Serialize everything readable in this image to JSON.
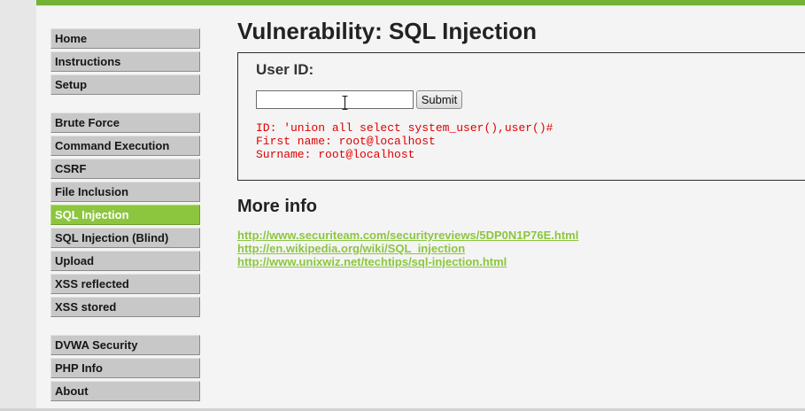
{
  "sidebar": {
    "groups": [
      [
        "Home",
        "Instructions",
        "Setup"
      ],
      [
        "Brute Force",
        "Command Execution",
        "CSRF",
        "File Inclusion",
        "SQL Injection",
        "SQL Injection (Blind)",
        "Upload",
        "XSS reflected",
        "XSS stored"
      ],
      [
        "DVWA Security",
        "PHP Info",
        "About"
      ]
    ],
    "selected": "SQL Injection"
  },
  "main": {
    "title": "Vulnerability: SQL Injection",
    "form": {
      "label": "User ID:",
      "input_value": "",
      "submit_label": "Submit"
    },
    "result": {
      "lines": [
        "ID: 'union all select system_user(),user()#",
        "First name: root@localhost",
        "Surname: root@localhost"
      ]
    },
    "more_info": {
      "heading": "More info",
      "links": [
        "http://www.securiteam.com/securityreviews/5DP0N1P76E.html",
        "http://en.wikipedia.org/wiki/SQL_injection",
        "http://www.unixwiz.net/techtips/sql-injection.html"
      ]
    }
  },
  "colors": {
    "accent": "#8cc63f",
    "top_bar": "#73b234",
    "result_text": "#e00000",
    "menu_bg": "#c8c8c8"
  }
}
